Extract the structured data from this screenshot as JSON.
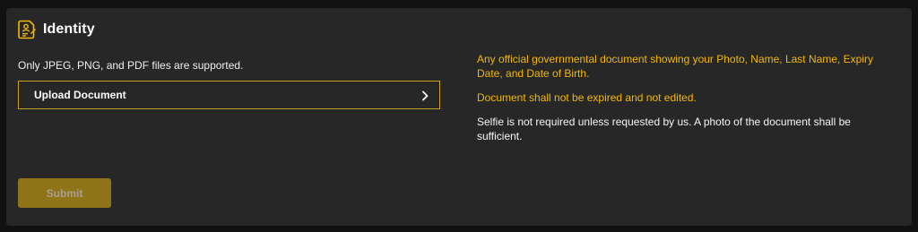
{
  "section": {
    "title": "Identity",
    "icon": "id-document-icon"
  },
  "upload": {
    "supported_text": "Only JPEG, PNG, and PDF files are supported.",
    "button_label": "Upload Document",
    "chevron_icon": "chevron-right-icon"
  },
  "info": {
    "line1": "Any official governmental document showing your Photo, Name, Last Name, Expiry Date, and Date of Birth.",
    "line2": "Document shall not be expired and not edited.",
    "line3": "Selfie is not required unless requested by us. A photo of the document shall be sufficient."
  },
  "actions": {
    "submit_label": "Submit"
  },
  "colors": {
    "accent": "#c9a224",
    "info_text": "#f2b705",
    "submit_disabled": "#8f7419",
    "panel_bg": "#272727",
    "page_bg": "#111111"
  }
}
